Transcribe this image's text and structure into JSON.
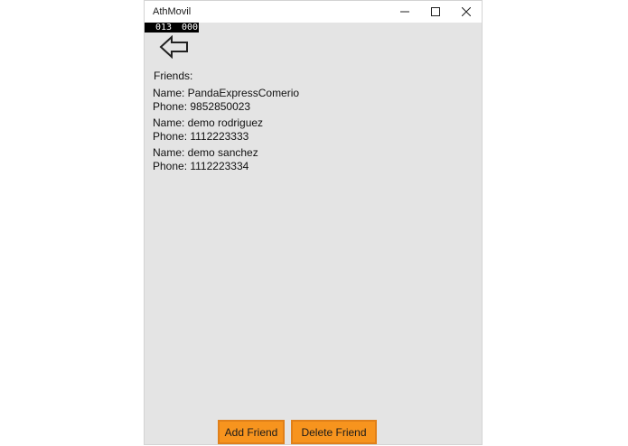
{
  "window": {
    "title": "AthMovil",
    "controls": {
      "minimize_icon": "minimize-icon",
      "maximize_icon": "maximize-icon",
      "close_icon": "close-icon"
    }
  },
  "counter": {
    "left": "013",
    "right": "000"
  },
  "back_icon": "back-arrow-icon",
  "friends": {
    "heading": "Friends:",
    "items": [
      {
        "name": "Name: PandaExpressComerio",
        "phone": "Phone: 9852850023"
      },
      {
        "name": "Name: demo rodriguez",
        "phone": "Phone: 1112223333"
      },
      {
        "name": "Name: demo sanchez",
        "phone": "Phone: 1112223334"
      }
    ]
  },
  "actions": {
    "add_label": "Add Friend",
    "delete_label": "Delete Friend"
  },
  "colors": {
    "window_bg": "#e4e4e4",
    "button_bg": "#f7941e",
    "counter_bg": "#000000"
  }
}
